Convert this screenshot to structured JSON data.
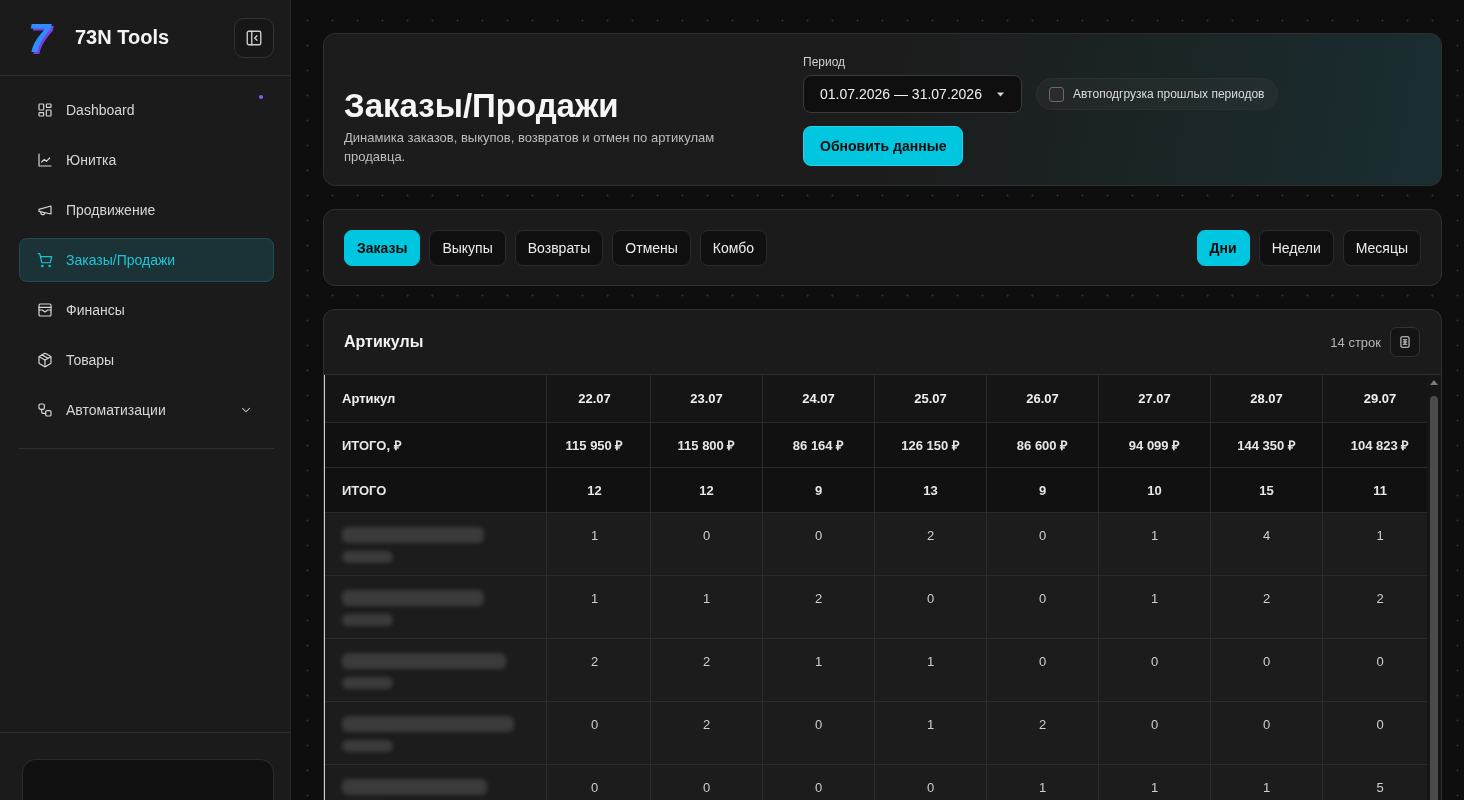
{
  "sidebar": {
    "logo_mark": "7",
    "brand": "73N Tools",
    "items": [
      {
        "label": "Dashboard",
        "kind": "link",
        "selected": false,
        "notification": true
      },
      {
        "label": "Юнитка",
        "kind": "link",
        "selected": false,
        "notification": false
      },
      {
        "label": "Продвижение",
        "kind": "link",
        "selected": false,
        "notification": false
      },
      {
        "label": "Заказы/Продажи",
        "kind": "link",
        "selected": true,
        "notification": false
      },
      {
        "label": "Финансы",
        "kind": "link",
        "selected": false,
        "notification": false
      },
      {
        "label": "Товары",
        "kind": "link",
        "selected": false,
        "notification": false
      },
      {
        "label": "Автоматизации",
        "kind": "group",
        "selected": false,
        "notification": false,
        "expanded": false
      }
    ]
  },
  "header": {
    "title": "Заказы/Продажи",
    "subtitle": "Динамика заказов, выкупов, возвратов и отмен по артикулам продавца.",
    "period": {
      "label": "Период",
      "value": "01.07.2026 — 31.07.2026"
    },
    "autoload": {
      "label": "Автоподгрузка прошлых периодов",
      "checked": false
    },
    "refresh_button": "Обновить данные"
  },
  "metric_tabs": [
    {
      "label": "Заказы",
      "selected": true
    },
    {
      "label": "Выкупы",
      "selected": false
    },
    {
      "label": "Возвраты",
      "selected": false
    },
    {
      "label": "Отмены",
      "selected": false
    },
    {
      "label": "Комбо",
      "selected": false
    }
  ],
  "period_tabs": [
    {
      "label": "Дни",
      "selected": true
    },
    {
      "label": "Недели",
      "selected": false
    },
    {
      "label": "Месяцы",
      "selected": false
    }
  ],
  "table": {
    "title": "Артикулы",
    "row_count": "14 строк",
    "columns": [
      "Артикул",
      "22.07",
      "23.07",
      "24.07",
      "25.07",
      "26.07",
      "27.07",
      "28.07",
      "29.07"
    ],
    "totals": [
      {
        "label": "ИТОГО, ₽",
        "values": [
          "115 950 ₽",
          "115 800 ₽",
          "86 164 ₽",
          "126 150 ₽",
          "86 600 ₽",
          "94 099 ₽",
          "144 350 ₽",
          "104 823 ₽"
        ]
      },
      {
        "label": "ИТОГО",
        "values": [
          "12",
          "12",
          "9",
          "13",
          "9",
          "10",
          "15",
          "11"
        ]
      }
    ],
    "rows": [
      {
        "values": [
          "1",
          "0",
          "0",
          "2",
          "0",
          "1",
          "4",
          "1"
        ]
      },
      {
        "values": [
          "1",
          "1",
          "2",
          "0",
          "0",
          "1",
          "2",
          "2"
        ]
      },
      {
        "values": [
          "2",
          "2",
          "1",
          "1",
          "0",
          "0",
          "0",
          "0"
        ]
      },
      {
        "values": [
          "0",
          "2",
          "0",
          "1",
          "2",
          "0",
          "0",
          "0"
        ]
      },
      {
        "values": [
          "0",
          "0",
          "0",
          "0",
          "1",
          "1",
          "1",
          "5"
        ]
      }
    ]
  }
}
